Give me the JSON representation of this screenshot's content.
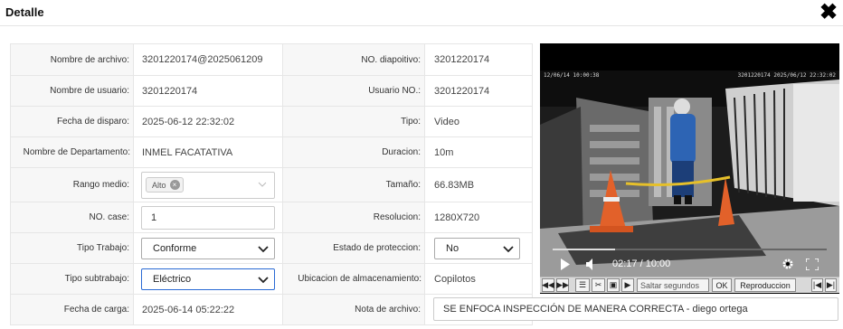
{
  "header": {
    "title": "Detalle",
    "close_icon": "close-icon"
  },
  "fields": {
    "nombre_archivo": {
      "label": "Nombre de archivo:",
      "value": "3201220174@2025061209"
    },
    "no_dispositivo": {
      "label": "NO. diapoitivo:",
      "value": "3201220174"
    },
    "nombre_usuario": {
      "label": "Nombre de usuario:",
      "value": "3201220174"
    },
    "usuario_no": {
      "label": "Usuario NO.:",
      "value": "3201220174"
    },
    "fecha_disparo": {
      "label": "Fecha de disparo:",
      "value": "2025-06-12 22:32:02"
    },
    "tipo": {
      "label": "Tipo:",
      "value": "Video"
    },
    "departamento": {
      "label": "Nombre de Departamento:",
      "value": "INMEL FACATATIVA"
    },
    "duracion": {
      "label": "Duracion:",
      "value": "10m"
    },
    "rango_medio": {
      "label": "Rango medio:",
      "tag": "Alto"
    },
    "tamano": {
      "label": "Tamaño:",
      "value": "66.83MB"
    },
    "no_case": {
      "label": "NO. case:",
      "value": "1"
    },
    "resolucion": {
      "label": "Resolucion:",
      "value": "1280X720"
    },
    "tipo_trabajo": {
      "label": "Tipo Trabajo:",
      "value": "Conforme"
    },
    "estado_proteccion": {
      "label": "Estado de proteccion:",
      "value": "No"
    },
    "tipo_subtrabajo": {
      "label": "Tipo subtrabajo:",
      "value": "Eléctrico"
    },
    "ubicacion": {
      "label": "Ubicacion de almacenamiento:",
      "value": "Copilotos"
    },
    "fecha_carga": {
      "label": "Fecha de carga:",
      "value": "2025-06-14 05:22:22"
    },
    "nota": {
      "label": "Nota de archivo:",
      "value": "SE ENFOCA INSPECCIÓN DE MANERA CORRECTA - diego ortega"
    }
  },
  "player": {
    "osd_left": "12/06/14 10:00:38",
    "osd_right": "3201220174 2025/06/12 22:32:02",
    "time": "02:17 / 10:00",
    "progress": 0.228,
    "icons": [
      "play-icon",
      "volume-icon",
      "gear-icon",
      "fullscreen-icon"
    ]
  },
  "toolbar": {
    "skip_seconds_placeholder": "Saltar segundos",
    "ok_label": "OK",
    "playback_label": "Reproduccion"
  },
  "colors": {
    "focus_border": "#2a6ad4",
    "label_bg": "#f7f7f7"
  }
}
